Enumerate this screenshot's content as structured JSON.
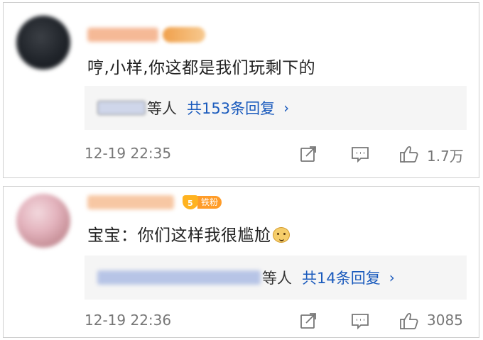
{
  "comments": [
    {
      "content": "哼,小样,你这都是我们玩剩下的",
      "reply_suffix": "等人",
      "reply_count": "共153条回复",
      "chevron": "›",
      "time": "12-19 22:35",
      "likes": "1.7万",
      "badge": "vip"
    },
    {
      "content": "宝宝：你们这样我很尴尬",
      "emoji": "doge-emoji",
      "reply_suffix": "等人",
      "reply_count": "共14条回复",
      "chevron": "›",
      "time": "12-19 22:36",
      "likes": "3085",
      "badge": "fan",
      "fan_level": "5",
      "fan_label": "铁粉"
    }
  ],
  "icons": {
    "share": "share-icon",
    "comment": "comment-icon",
    "like": "thumbs-up-icon"
  },
  "colors": {
    "link": "#1b5bbd",
    "fan_badge": "#ff9c28",
    "reply_bg": "#f5f5f5"
  }
}
